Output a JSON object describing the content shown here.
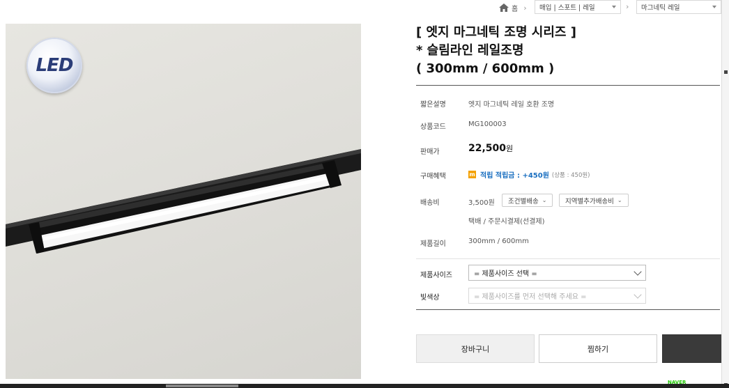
{
  "breadcrumb": {
    "home_label": "홈",
    "category1": "매입 | 스포트 | 레일",
    "category2": "마그네틱 레일"
  },
  "image": {
    "badge_text": "LED"
  },
  "product": {
    "title_line1": "[ 엣지 마그네틱 조명 시리즈 ]",
    "title_line2": "* 슬림라인 레일조명",
    "title_line3": "( 300mm / 600mm )"
  },
  "details": {
    "summary_label": "짧은설명",
    "summary_value": "엣지 마그네틱 레일 호환 조명",
    "code_label": "상품코드",
    "code_value": "MG100003",
    "price_label": "판매가",
    "price_value": "22,500",
    "price_unit": "원",
    "benefit_label": "구매혜택",
    "benefit_icon": "m",
    "benefit_text": "적립 적립금 : +450원",
    "benefit_note": "(상품 : 450원)",
    "shipping_label": "배송비",
    "shipping_value": "3,500원",
    "shipping_btn1": "조건별배송",
    "shipping_btn2": "지역별추가배송비",
    "shipping_method": "택배  /  주문시결제(선결제)",
    "length_label": "제품길이",
    "length_value": "300mm / 600mm"
  },
  "options": {
    "size_label": "제품사이즈",
    "size_value": "= 제품사이즈 선택 =",
    "color_label": "빛색상",
    "color_value": "= 제품사이즈를 먼저 선택해 주세요 ="
  },
  "actions": {
    "cart": "장바구니",
    "wish": "찜하기",
    "buy": ""
  },
  "footer": {
    "naver": "NAVER"
  },
  "colors": {
    "accent_blue": "#1a6fc0",
    "point_orange": "#f4a100",
    "buy_button": "#3a3a3a"
  }
}
